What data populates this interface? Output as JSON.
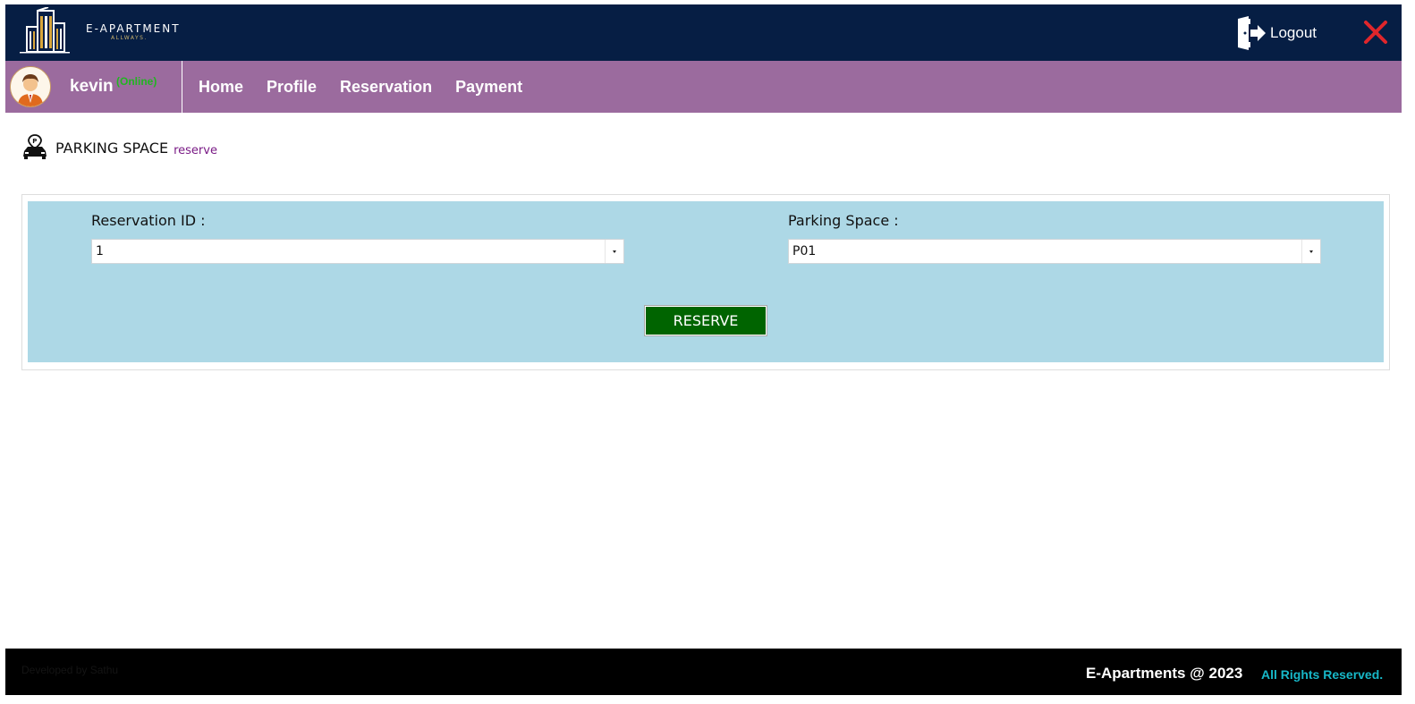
{
  "header": {
    "brand_name": "E-APARTMENT",
    "brand_tagline": "ALLWAYS.",
    "logout_label": "Logout",
    "accent_color": "#061e44"
  },
  "user": {
    "name": "kevin",
    "status": "(Online)"
  },
  "nav": {
    "items": [
      {
        "label": "Home"
      },
      {
        "label": "Profile"
      },
      {
        "label": "Reservation"
      },
      {
        "label": "Payment"
      }
    ],
    "color": "#9b6b9e"
  },
  "page": {
    "title": "PARKING SPACE",
    "subtitle": "reserve"
  },
  "form": {
    "reservation_id_label": "Reservation ID :",
    "reservation_id_value": "1",
    "parking_space_label": "Parking Space :",
    "parking_space_value": "P01",
    "reserve_button": "RESERVE",
    "panel_color": "#add8e6",
    "button_color": "#006400"
  },
  "footer": {
    "developer": "Developed by Sathu",
    "copyright": "E-Apartments @ 2023",
    "rights": "All Rights Reserved."
  },
  "icons": [
    "building-logo-icon",
    "logout-door-icon",
    "close-icon",
    "user-avatar-icon",
    "parking-car-icon",
    "chevron-down-icon"
  ]
}
